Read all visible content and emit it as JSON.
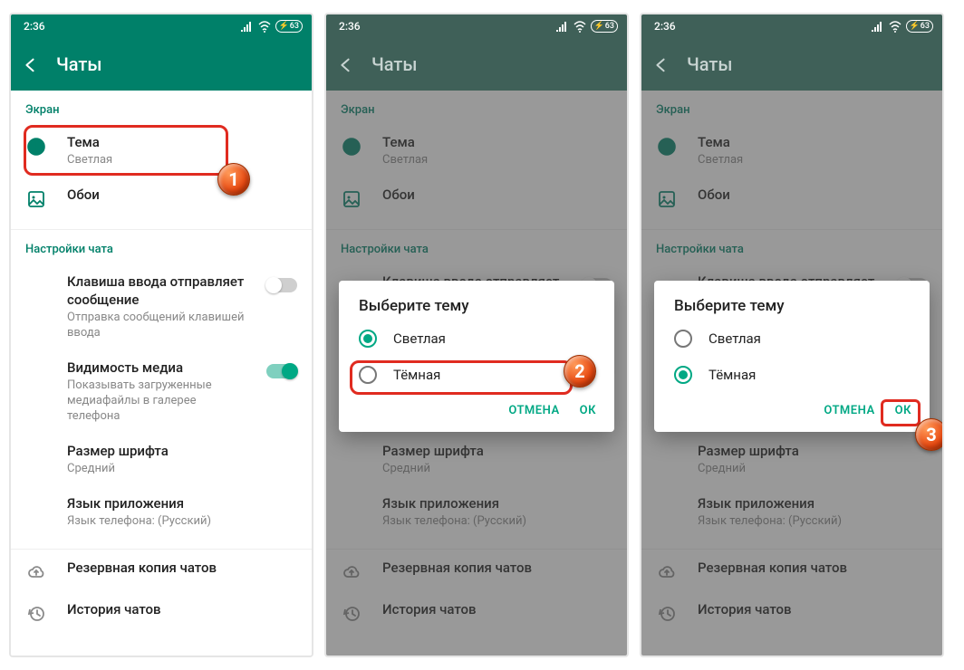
{
  "status": {
    "time": "2:36",
    "battery": "63"
  },
  "appbar": {
    "title": "Чаты"
  },
  "sections": {
    "screen_label": "Экран",
    "chatsettings_label": "Настройки чата"
  },
  "rows": {
    "theme": {
      "title": "Тема",
      "sub": "Светлая"
    },
    "wallpaper": {
      "title": "Обои"
    },
    "enterkey": {
      "title": "Клавиша ввода отправляет сообщение",
      "sub": "Отправка сообщений клавишей ввода"
    },
    "media": {
      "title": "Видимость медиа",
      "sub": "Показывать загруженные медиафайлы в галерее телефона"
    },
    "fontsize": {
      "title": "Размер шрифта",
      "sub": "Средний"
    },
    "applang": {
      "title": "Язык приложения",
      "sub": "Язык телефона: (Русский)"
    },
    "backup": {
      "title": "Резервная копия чатов"
    },
    "history": {
      "title": "История чатов"
    }
  },
  "dialog": {
    "title": "Выберите тему",
    "opt_light": "Светлая",
    "opt_dark": "Тёмная",
    "cancel": "ОТМЕНА",
    "ok": "ОК"
  },
  "steps": {
    "s1": "1",
    "s2": "2",
    "s3": "3"
  }
}
